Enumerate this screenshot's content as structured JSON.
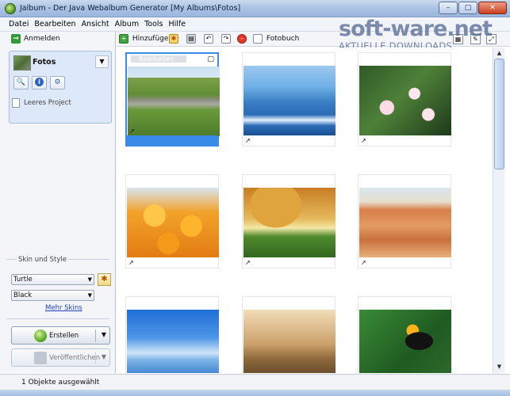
{
  "window": {
    "title": "Jalbum - Der Java Webalbum Generator [My Albums\\Fotos]",
    "minimize": "–",
    "maximize": "□",
    "close": "✕"
  },
  "watermark": {
    "main": "soft-ware.net",
    "sub": "AKTUELLE DOWNLOADS"
  },
  "menu": [
    "Datei",
    "Bearbeiten",
    "Ansicht",
    "Album",
    "Tools",
    "Hilfe"
  ],
  "sidebar": {
    "login_label": "Anmelden",
    "album_name": "Fotos",
    "project_label": "Leeres Project",
    "skin_section_label": "Skin und Style",
    "skin_value": "Turtle",
    "style_value": "Black",
    "more_skins": "Mehr Skins",
    "create_label": "Erstellen",
    "publish_label": "Veröffentlichen"
  },
  "toolbar": {
    "add_label": "Hinzufügen",
    "photobook_label": "Fotobuch"
  },
  "content": {
    "selected_edit_label": "Bearbeiten"
  },
  "statusbar": {
    "text": "1 Objekte ausgewählt"
  },
  "colors": {
    "selection": "#3a8be8",
    "link": "#1b3fbf"
  }
}
